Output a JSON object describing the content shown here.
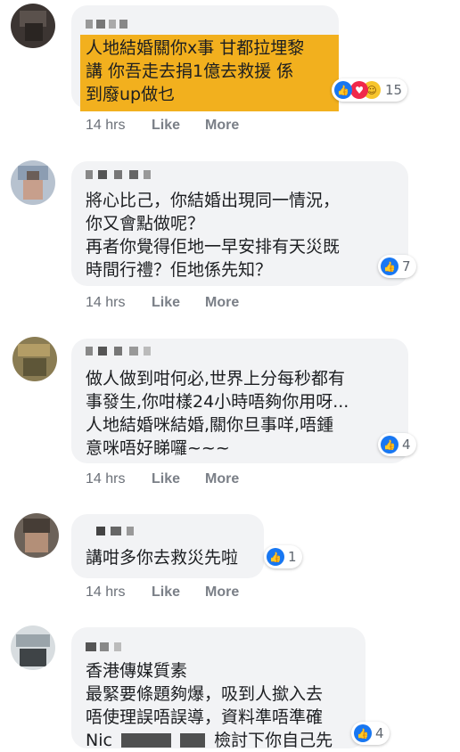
{
  "comments": [
    {
      "text": "人地結婚關你x事 甘都拉埋黎\n講 你吾走去捐1億去救援 係\n到廢up做乜",
      "reaction_count": "15",
      "time": "14 hrs",
      "like": "Like",
      "more": "More"
    },
    {
      "text": "將心比己，你結婚出現同一情況，\n你又會點做呢？\n再者你覺得佢地一早安排有天災既\n時間行禮？佢地係先知？",
      "reaction_count": "7",
      "time": "14 hrs",
      "like": "Like",
      "more": "More"
    },
    {
      "text": "做人做到咁何必,世界上分每秒都有\n事發生,你咁樣24小時唔夠你用呀...\n人地結婚咪結婚,關你旦事咩,唔鍾\n意咪唔好睇囉~~~",
      "reaction_count": "4",
      "time": "14 hrs",
      "like": "Like",
      "more": "More"
    },
    {
      "text": "講咁多你去救災先啦",
      "reaction_count": "1",
      "time": "14 hrs",
      "like": "Like",
      "more": "More"
    },
    {
      "text": "香港傳媒質素\n最緊要條題夠爆，吸到人撳入去\n唔使理誤唔誤導，資料準唔準確",
      "text_last_a": "Nic",
      "text_last_b": "檢討下你自己先",
      "reaction_count": "4"
    }
  ],
  "colors": {
    "highlight": "#f2b01e",
    "bubble": "#f2f3f5",
    "like_blue": "#1877f2"
  },
  "icons": {
    "like": "thumbs-up-icon",
    "love": "heart-icon",
    "haha": "laugh-icon"
  }
}
